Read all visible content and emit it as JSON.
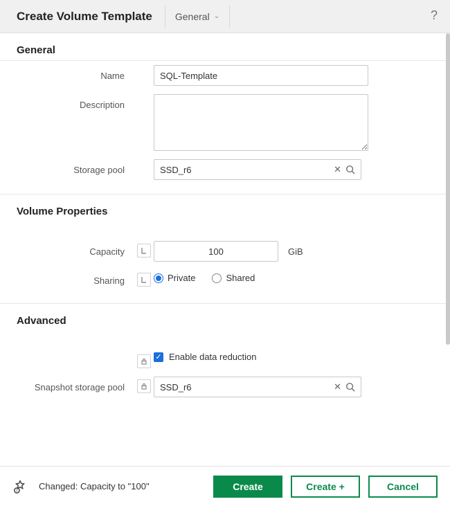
{
  "header": {
    "title": "Create Volume Template",
    "dropdown_label": "General",
    "help_glyph": "?"
  },
  "sections": {
    "general": {
      "title": "General",
      "name_label": "Name",
      "name_value": "SQL-Template",
      "description_label": "Description",
      "description_value": "",
      "pool_label": "Storage pool",
      "pool_value": "SSD_r6"
    },
    "volume_props": {
      "title": "Volume Properties",
      "capacity_label": "Capacity",
      "capacity_value": "100",
      "capacity_unit": "GiB",
      "sharing_label": "Sharing",
      "sharing_private": "Private",
      "sharing_shared": "Shared",
      "sharing_selected": "private"
    },
    "advanced": {
      "title": "Advanced",
      "data_reduction_label": "Enable data reduction",
      "data_reduction_checked": true,
      "snapshot_pool_label": "Snapshot storage pool",
      "snapshot_pool_value": "SSD_r6"
    }
  },
  "footer": {
    "status": "Changed: Capacity to \"100\"",
    "create_label": "Create",
    "create_plus_label": "Create +",
    "cancel_label": "Cancel"
  },
  "colors": {
    "primary_green": "#0a8a4a",
    "accent_blue": "#1a6fdc"
  }
}
